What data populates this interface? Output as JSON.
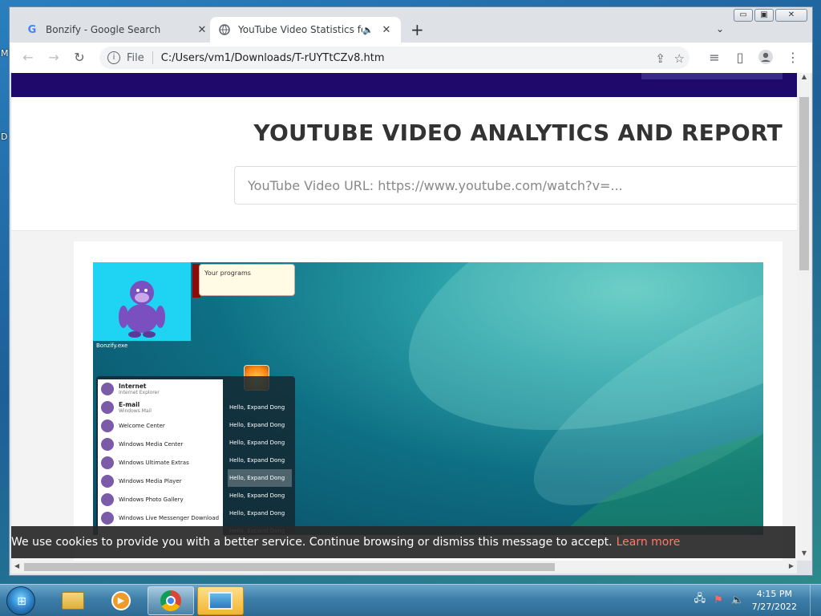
{
  "desktop": {
    "edge_text_1": "M",
    "edge_text_2": "D"
  },
  "browser": {
    "tabs": [
      {
        "title": "Bonzify - Google Search",
        "favicon": "google-g-icon"
      },
      {
        "title": "YouTube Video Statistics for ...",
        "favicon": "globe-icon",
        "audio": true
      }
    ],
    "new_tab_label": "+",
    "address": {
      "scheme_label": "File",
      "url": "C:/Users/vm1/Downloads/T-rUYTtCZv8.htm"
    },
    "caption": {
      "minimize": "▭",
      "maximize": "▣",
      "close": "✕"
    }
  },
  "page": {
    "heading": "YOUTUBE VIDEO ANALYTICS AND REPORT",
    "search_placeholder": "YouTube Video URL: https://www.youtube.com/watch?v=...",
    "video": {
      "bubble_text": "Your programs",
      "bonzi_caption": "Bonzify.exe",
      "start_left": [
        {
          "title": "Internet",
          "sub": "Internet Explorer"
        },
        {
          "title": "E-mail",
          "sub": "Windows Mail"
        },
        {
          "title": "Welcome Center",
          "sub": ""
        },
        {
          "title": "Windows Media Center",
          "sub": ""
        },
        {
          "title": "Windows Ultimate Extras",
          "sub": ""
        },
        {
          "title": "Windows Media Player",
          "sub": ""
        },
        {
          "title": "Windows Photo Gallery",
          "sub": ""
        },
        {
          "title": "Windows Live Messenger Download",
          "sub": ""
        }
      ],
      "start_right": [
        "Hello, Expand Dong",
        "Hello, Expand Dong",
        "Hello, Expand Dong",
        "Hello, Expand Dong",
        "Hello, Expand Dong",
        "Hello, Expand Dong",
        "Hello, Expand Dong",
        "Hello, Expand Dong"
      ]
    },
    "cookie": {
      "message": "We use cookies to provide you with a better service. Continue browsing or dismiss this message to accept.",
      "link": "Learn more"
    }
  },
  "taskbar": {
    "clock_time": "4:15 PM",
    "clock_date": "7/27/2022"
  }
}
